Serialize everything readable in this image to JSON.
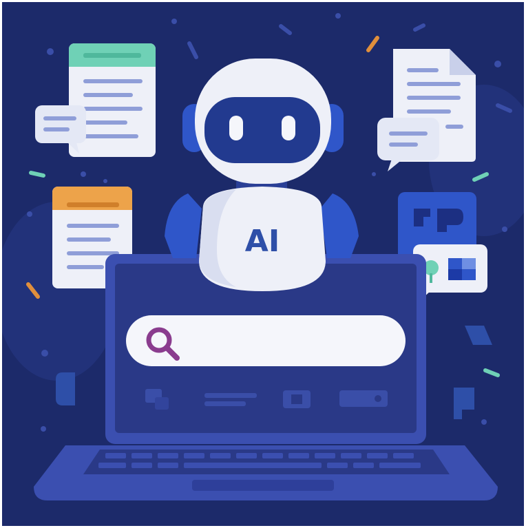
{
  "robot": {
    "chest_label": "AI"
  },
  "colors": {
    "background": "#1c2a6a",
    "laptop_body": "#3b4fb0",
    "laptop_screen": "#2a3987",
    "robot_shell": "#eef0f8",
    "robot_visor": "#223a8f",
    "accent_green": "#6fd1b6",
    "accent_orange": "#eda34a",
    "search_icon": "#8a3c8e"
  },
  "icons": [
    "robot-icon",
    "search-icon",
    "document-icon",
    "speech-bubble-icon",
    "laptop-icon"
  ]
}
